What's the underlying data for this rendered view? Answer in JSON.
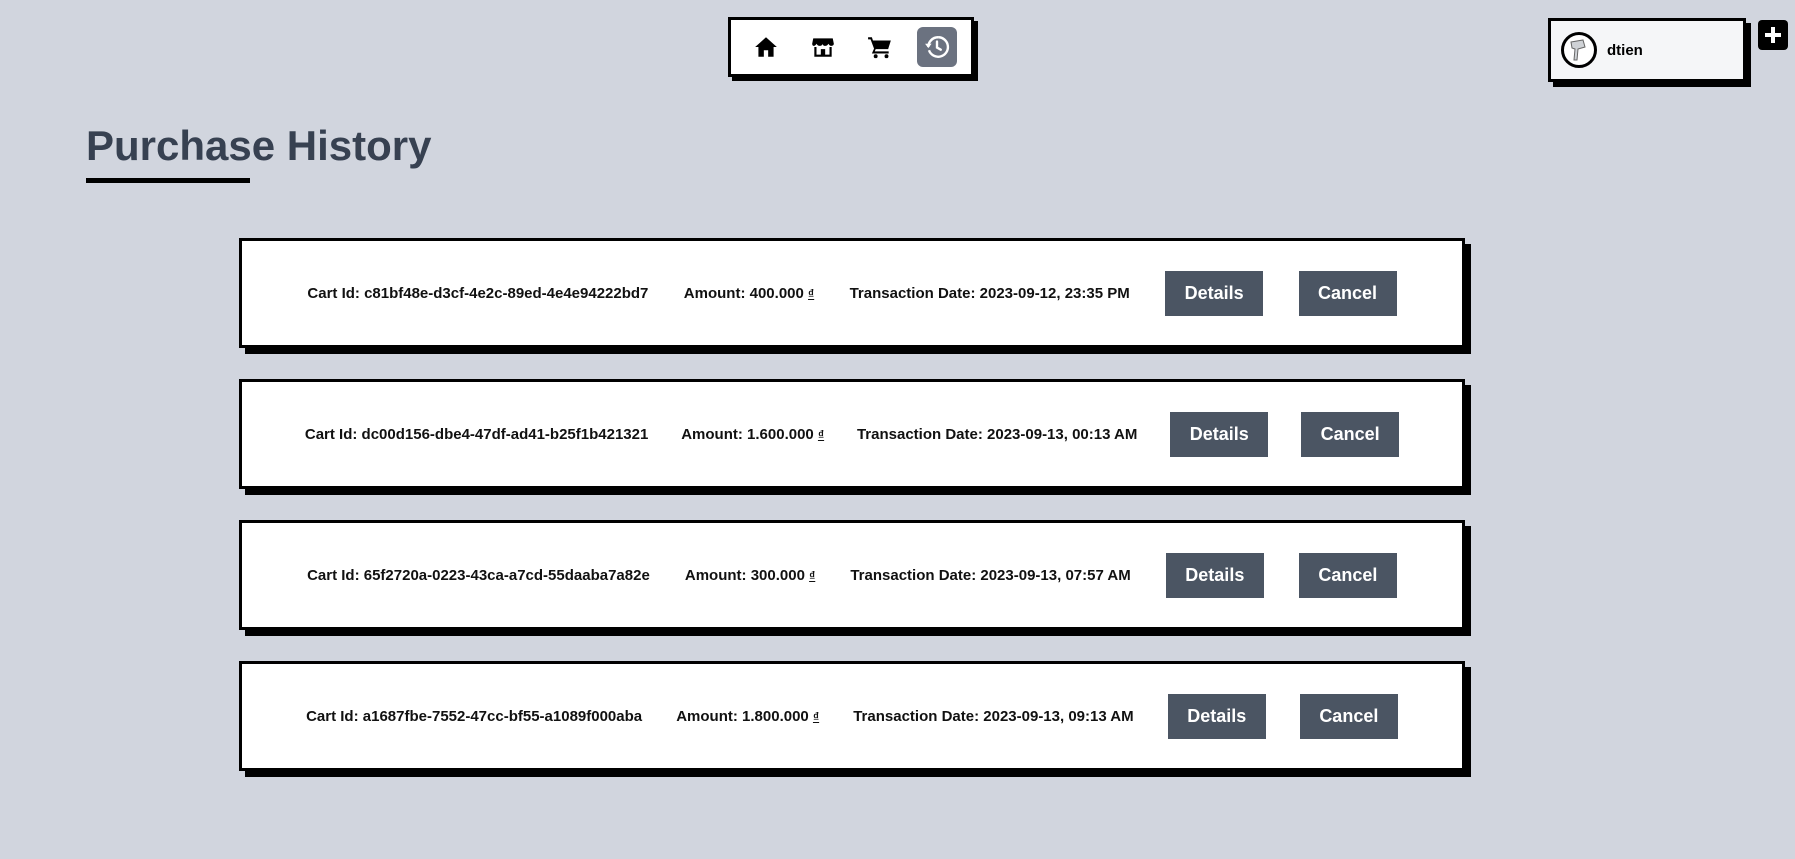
{
  "nav": {
    "items": [
      {
        "name": "home-icon",
        "active": false
      },
      {
        "name": "store-icon",
        "active": false
      },
      {
        "name": "cart-icon",
        "active": false
      },
      {
        "name": "history-icon",
        "active": true
      }
    ]
  },
  "user": {
    "name": "dtien",
    "add_label": "+"
  },
  "page": {
    "title": "Purchase History"
  },
  "labels": {
    "cart_id": "Cart Id:",
    "amount": "Amount:",
    "date": "Transaction Date:",
    "details": "Details",
    "cancel": "Cancel",
    "currency": "₫"
  },
  "orders": [
    {
      "cart_id": "c81bf48e-d3cf-4e2c-89ed-4e4e94222bd7",
      "amount": "400.000",
      "date": "2023-09-12, 23:35 PM"
    },
    {
      "cart_id": "dc00d156-dbe4-47df-ad41-b25f1b421321",
      "amount": "1.600.000",
      "date": "2023-09-13, 00:13 AM"
    },
    {
      "cart_id": "65f2720a-0223-43ca-a7cd-55daaba7a82e",
      "amount": "300.000",
      "date": "2023-09-13, 07:57 AM"
    },
    {
      "cart_id": "a1687fbe-7552-47cc-bf55-a1089f000aba",
      "amount": "1.800.000",
      "date": "2023-09-13, 09:13 AM"
    }
  ]
}
